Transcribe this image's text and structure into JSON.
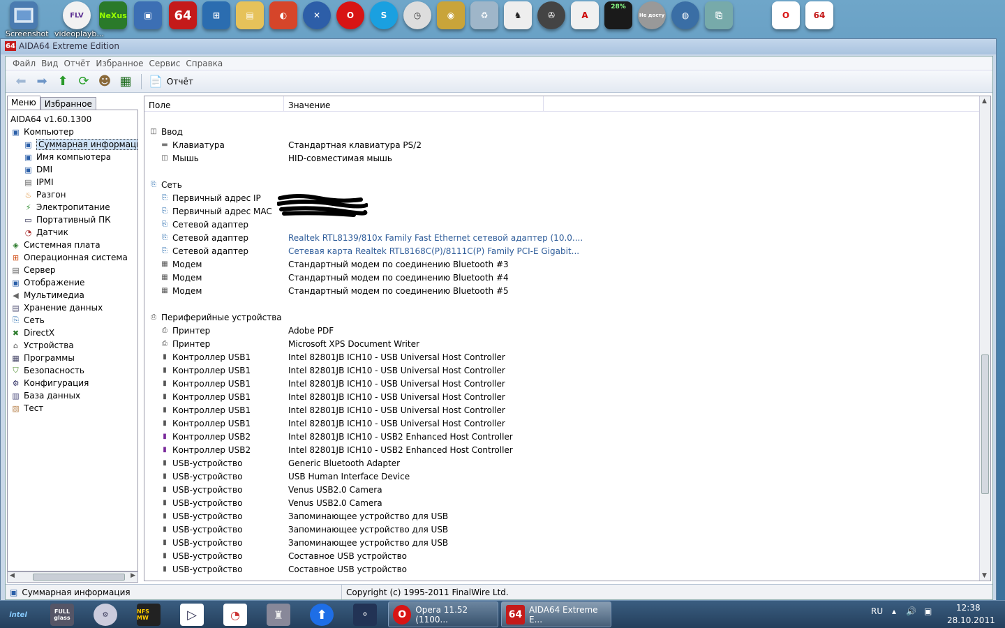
{
  "dock": {
    "screenshot_label": "Screenshot",
    "videoplayback_label": "videoplayb...",
    "nexus_label": "NeXus",
    "flv_label": "FLV",
    "aida_label": "64",
    "cpu_meter_label": "28%",
    "unavailable_label": "Не досту"
  },
  "window": {
    "title": "AIDA64 Extreme Edition",
    "badge": "64"
  },
  "menubar": [
    "Файл",
    "Вид",
    "Отчёт",
    "Избранное",
    "Сервис",
    "Справка"
  ],
  "toolbar": {
    "report_label": "Отчёт"
  },
  "left_tabs": {
    "menu": "Меню",
    "favorites": "Избранное"
  },
  "tree": [
    {
      "label": "AIDA64 v1.60.1300",
      "level": 0,
      "icon": "none"
    },
    {
      "label": "Компьютер",
      "level": 0,
      "icon": "computer-icon"
    },
    {
      "label": "Суммарная информация",
      "level": 1,
      "icon": "computer-icon",
      "selected": true
    },
    {
      "label": "Имя компьютера",
      "level": 1,
      "icon": "computer-icon"
    },
    {
      "label": "DMI",
      "level": 1,
      "icon": "computer-icon"
    },
    {
      "label": "IPMI",
      "level": 1,
      "icon": "server-icon"
    },
    {
      "label": "Разгон",
      "level": 1,
      "icon": "flame-icon"
    },
    {
      "label": "Электропитание",
      "level": 1,
      "icon": "power-icon"
    },
    {
      "label": "Портативный ПК",
      "level": 1,
      "icon": "laptop-icon"
    },
    {
      "label": "Датчик",
      "level": 1,
      "icon": "gauge-icon"
    },
    {
      "label": "Системная плата",
      "level": 0,
      "icon": "motherboard-icon"
    },
    {
      "label": "Операционная система",
      "level": 0,
      "icon": "windows-icon"
    },
    {
      "label": "Сервер",
      "level": 0,
      "icon": "server-icon"
    },
    {
      "label": "Отображение",
      "level": 0,
      "icon": "monitor-icon"
    },
    {
      "label": "Мультимедиа",
      "level": 0,
      "icon": "speaker-icon"
    },
    {
      "label": "Хранение данных",
      "level": 0,
      "icon": "disk-icon"
    },
    {
      "label": "Сеть",
      "level": 0,
      "icon": "network-icon"
    },
    {
      "label": "DirectX",
      "level": 0,
      "icon": "directx-icon"
    },
    {
      "label": "Устройства",
      "level": 0,
      "icon": "devices-icon"
    },
    {
      "label": "Программы",
      "level": 0,
      "icon": "programs-icon"
    },
    {
      "label": "Безопасность",
      "level": 0,
      "icon": "shield-icon"
    },
    {
      "label": "Конфигурация",
      "level": 0,
      "icon": "config-icon"
    },
    {
      "label": "База данных",
      "level": 0,
      "icon": "database-icon"
    },
    {
      "label": "Тест",
      "level": 0,
      "icon": "test-icon"
    }
  ],
  "columns": {
    "field": "Поле",
    "value": "Значение"
  },
  "rows": [
    {
      "type": "group",
      "field": "Ввод",
      "value": "",
      "icon": "mouse-icon",
      "slot": 1
    },
    {
      "type": "item",
      "field": "Клавиатура",
      "value": "Стандартная клавиатура PS/2",
      "icon": "keyboard-icon",
      "slot": 2
    },
    {
      "type": "item",
      "field": "Мышь",
      "value": "HID-совместимая мышь",
      "icon": "mouse-icon",
      "slot": 3
    },
    {
      "type": "group",
      "field": "Сеть",
      "value": "",
      "icon": "network-icon",
      "slot": 5
    },
    {
      "type": "item",
      "field": "Первичный адрес IP",
      "value": "",
      "icon": "network-icon",
      "slot": 6
    },
    {
      "type": "item",
      "field": "Первичный адрес MAC",
      "value": "",
      "icon": "network-icon",
      "slot": 7
    },
    {
      "type": "item",
      "field": "Сетевой адаптер",
      "value": "",
      "icon": "network-icon",
      "slot": 8
    },
    {
      "type": "item",
      "field": "Сетевой адаптер",
      "value": "Realtek RTL8139/810x Family Fast Ethernet сетевой адаптер  (10.0....",
      "icon": "network-icon",
      "link": true,
      "slot": 9
    },
    {
      "type": "item",
      "field": "Сетевой адаптер",
      "value": "Сетевая карта Realtek RTL8168C(P)/8111C(P) Family PCI-E Gigabit...",
      "icon": "network-icon",
      "link": true,
      "slot": 10
    },
    {
      "type": "item",
      "field": "Модем",
      "value": "Стандартный модем по соединению Bluetooth #3",
      "icon": "modem-icon",
      "slot": 11
    },
    {
      "type": "item",
      "field": "Модем",
      "value": "Стандартный модем по соединению Bluetooth #4",
      "icon": "modem-icon",
      "slot": 12
    },
    {
      "type": "item",
      "field": "Модем",
      "value": "Стандартный модем по соединению Bluetooth #5",
      "icon": "modem-icon",
      "slot": 13
    },
    {
      "type": "group",
      "field": "Периферийные устройства",
      "value": "",
      "icon": "printer-icon",
      "slot": 15
    },
    {
      "type": "item",
      "field": "Принтер",
      "value": "Adobe PDF",
      "icon": "printer-icon",
      "slot": 16
    },
    {
      "type": "item",
      "field": "Принтер",
      "value": "Microsoft XPS Document Writer",
      "icon": "printer-icon",
      "slot": 17
    },
    {
      "type": "item",
      "field": "Контроллер USB1",
      "value": "Intel 82801JB ICH10 - USB Universal Host Controller",
      "icon": "usb-icon",
      "slot": 18
    },
    {
      "type": "item",
      "field": "Контроллер USB1",
      "value": "Intel 82801JB ICH10 - USB Universal Host Controller",
      "icon": "usb-icon",
      "slot": 19
    },
    {
      "type": "item",
      "field": "Контроллер USB1",
      "value": "Intel 82801JB ICH10 - USB Universal Host Controller",
      "icon": "usb-icon",
      "slot": 20
    },
    {
      "type": "item",
      "field": "Контроллер USB1",
      "value": "Intel 82801JB ICH10 - USB Universal Host Controller",
      "icon": "usb-icon",
      "slot": 21
    },
    {
      "type": "item",
      "field": "Контроллер USB1",
      "value": "Intel 82801JB ICH10 - USB Universal Host Controller",
      "icon": "usb-icon",
      "slot": 22
    },
    {
      "type": "item",
      "field": "Контроллер USB1",
      "value": "Intel 82801JB ICH10 - USB Universal Host Controller",
      "icon": "usb-icon",
      "slot": 23
    },
    {
      "type": "item",
      "field": "Контроллер USB2",
      "value": "Intel 82801JB ICH10 - USB2 Enhanced Host Controller",
      "icon": "usb2-icon",
      "slot": 24
    },
    {
      "type": "item",
      "field": "Контроллер USB2",
      "value": "Intel 82801JB ICH10 - USB2 Enhanced Host Controller",
      "icon": "usb2-icon",
      "slot": 25
    },
    {
      "type": "item",
      "field": "USB-устройство",
      "value": "Generic Bluetooth Adapter",
      "icon": "usb-icon",
      "slot": 26
    },
    {
      "type": "item",
      "field": "USB-устройство",
      "value": "USB Human Interface Device",
      "icon": "usb-icon",
      "slot": 27
    },
    {
      "type": "item",
      "field": "USB-устройство",
      "value": "Venus USB2.0 Camera",
      "icon": "usb-icon",
      "slot": 28
    },
    {
      "type": "item",
      "field": "USB-устройство",
      "value": "Venus USB2.0 Camera",
      "icon": "usb-icon",
      "slot": 29
    },
    {
      "type": "item",
      "field": "USB-устройство",
      "value": "Запоминающее устройство для USB",
      "icon": "usb-icon",
      "slot": 30
    },
    {
      "type": "item",
      "field": "USB-устройство",
      "value": "Запоминающее устройство для USB",
      "icon": "usb-icon",
      "slot": 31
    },
    {
      "type": "item",
      "field": "USB-устройство",
      "value": "Запоминающее устройство для USB",
      "icon": "usb-icon",
      "slot": 32
    },
    {
      "type": "item",
      "field": "USB-устройство",
      "value": "Составное USB устройство",
      "icon": "usb-icon",
      "slot": 33
    },
    {
      "type": "item",
      "field": "USB-устройство",
      "value": "Составное USB устройство",
      "icon": "usb-icon",
      "slot": 34
    }
  ],
  "statusbar": {
    "left": "Суммарная информация",
    "right": "Copyright (c) 1995-2011 FinalWire Ltd."
  },
  "taskbar": {
    "intel_label": "intel",
    "fullglass_label": "FULL glass",
    "nfs_label": "NFS MW",
    "opera_button": "Opera 11.52 (1100...",
    "aida_button": "AIDA64 Extreme E...",
    "aida_badge": "64",
    "lang": "RU",
    "time": "12:38",
    "date": "28.10.2011"
  },
  "colors": {
    "link": "#2f5d9a",
    "selection": "#cfe3f7",
    "aida_red": "#c41a1a",
    "opera_red": "#d81414"
  }
}
